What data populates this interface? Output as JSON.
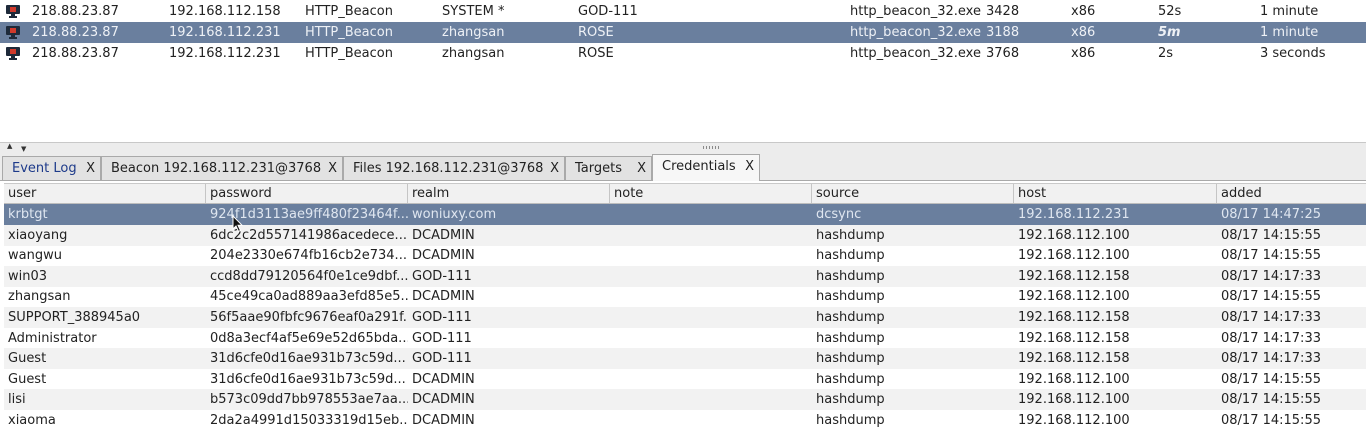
{
  "beacons": [
    {
      "external": "218.88.23.87",
      "internal": "192.168.112.158",
      "listener": "HTTP_Beacon",
      "user": "SYSTEM *",
      "computer": "GOD-111",
      "process": "http_beacon_32.exe",
      "pid": "3428",
      "arch": "x86",
      "last": "52s",
      "sleep": "1 minute",
      "selected": false
    },
    {
      "external": "218.88.23.87",
      "internal": "192.168.112.231",
      "listener": "HTTP_Beacon",
      "user": "zhangsan",
      "computer": "ROSE",
      "process": "http_beacon_32.exe",
      "pid": "3188",
      "arch": "x86",
      "last": "5m",
      "sleep": "1 minute",
      "selected": true
    },
    {
      "external": "218.88.23.87",
      "internal": "192.168.112.231",
      "listener": "HTTP_Beacon",
      "user": "zhangsan",
      "computer": "ROSE",
      "process": "http_beacon_32.exe",
      "pid": "3768",
      "arch": "x86",
      "last": "2s",
      "sleep": "3 seconds",
      "selected": false
    }
  ],
  "tabs": [
    {
      "label": "Event Log",
      "close": "X",
      "active": false
    },
    {
      "label": "Beacon 192.168.112.231@3768",
      "close": "X",
      "active": false
    },
    {
      "label": "Files 192.168.112.231@3768",
      "close": "X",
      "active": false
    },
    {
      "label": "Targets",
      "close": "X",
      "active": false
    },
    {
      "label": "Credentials",
      "close": "X",
      "active": true
    }
  ],
  "credentials": {
    "columns": [
      "user",
      "password",
      "realm",
      "note",
      "source",
      "host",
      "added"
    ],
    "rows": [
      {
        "user": "krbtgt",
        "password": "924f1d3113ae9ff480f23464f...",
        "realm": "woniuxy.com",
        "note": "",
        "source": "dcsync",
        "host": "192.168.112.231",
        "added": "08/17 14:47:25",
        "selected": true
      },
      {
        "user": "xiaoyang",
        "password": "6dc2c2d557141986acedece...",
        "realm": "DCADMIN",
        "note": "",
        "source": "hashdump",
        "host": "192.168.112.100",
        "added": "08/17 14:15:55"
      },
      {
        "user": "wangwu",
        "password": "204e2330e674fb16cb2e734...",
        "realm": "DCADMIN",
        "note": "",
        "source": "hashdump",
        "host": "192.168.112.100",
        "added": "08/17 14:15:55"
      },
      {
        "user": "win03",
        "password": "ccd8dd79120564f0e1ce9dbf...",
        "realm": "GOD-111",
        "note": "",
        "source": "hashdump",
        "host": "192.168.112.158",
        "added": "08/17 14:17:33"
      },
      {
        "user": "zhangsan",
        "password": "45ce49ca0ad889aa3efd85e5...",
        "realm": "DCADMIN",
        "note": "",
        "source": "hashdump",
        "host": "192.168.112.100",
        "added": "08/17 14:15:55"
      },
      {
        "user": "SUPPORT_388945a0",
        "password": "56f5aae90fbfc9676eaf0a291f...",
        "realm": "GOD-111",
        "note": "",
        "source": "hashdump",
        "host": "192.168.112.158",
        "added": "08/17 14:17:33"
      },
      {
        "user": "Administrator",
        "password": "0d8a3ecf4af5e69e52d65bda...",
        "realm": "GOD-111",
        "note": "",
        "source": "hashdump",
        "host": "192.168.112.158",
        "added": "08/17 14:17:33"
      },
      {
        "user": "Guest",
        "password": "31d6cfe0d16ae931b73c59d...",
        "realm": "GOD-111",
        "note": "",
        "source": "hashdump",
        "host": "192.168.112.158",
        "added": "08/17 14:17:33"
      },
      {
        "user": "Guest",
        "password": "31d6cfe0d16ae931b73c59d...",
        "realm": "DCADMIN",
        "note": "",
        "source": "hashdump",
        "host": "192.168.112.100",
        "added": "08/17 14:15:55"
      },
      {
        "user": "lisi",
        "password": "b573c09dd7bb978553ae7aa...",
        "realm": "DCADMIN",
        "note": "",
        "source": "hashdump",
        "host": "192.168.112.100",
        "added": "08/17 14:15:55"
      },
      {
        "user": "xiaoma",
        "password": "2da2a4991d15033319d15eb...",
        "realm": "DCADMIN",
        "note": "",
        "source": "hashdump",
        "host": "192.168.112.100",
        "added": "08/17 14:15:55"
      }
    ]
  },
  "colors": {
    "selection": "#6a7f9e",
    "alt_row": "#f2f2f2",
    "beacon_icon_dot": "#d03a2c"
  },
  "icons": {
    "beacon": "monitor-icon",
    "cursor": "mouse-cursor-icon",
    "splitter": "grip-icon"
  }
}
